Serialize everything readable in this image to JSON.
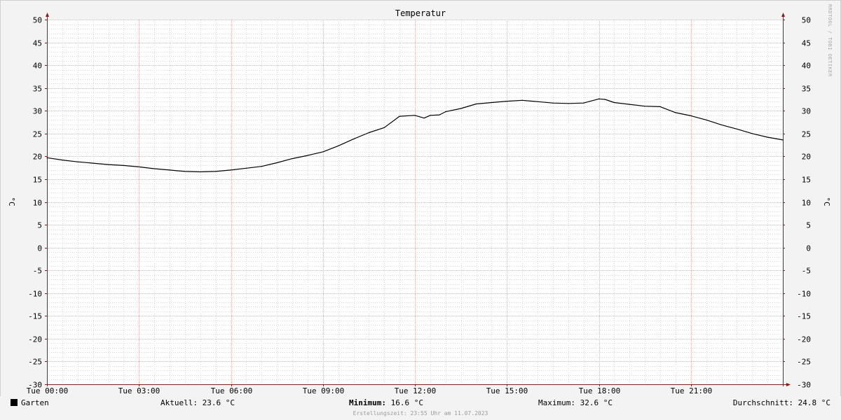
{
  "chart_data": {
    "type": "line",
    "title": "Temperatur",
    "ylabel_left": "°C",
    "ylabel_right": "°C",
    "ylim": [
      -30,
      50
    ],
    "y_ticks": [
      50,
      45,
      40,
      35,
      30,
      25,
      20,
      15,
      10,
      5,
      0,
      -5,
      -10,
      -15,
      -20,
      -25,
      -30
    ],
    "x_ticks": [
      "Tue 00:00",
      "Tue 03:00",
      "Tue 06:00",
      "Tue 09:00",
      "Tue 12:00",
      "Tue 15:00",
      "Tue 18:00",
      "Tue 21:00"
    ],
    "x_unit": "hours",
    "xlim": [
      0,
      24
    ],
    "grid": true,
    "colors": {
      "line": "#000000",
      "major_grid": "#f0a8a8",
      "minor_grid": "#d8d8d8",
      "axis": "#8b1a1a",
      "plot_bg": "#ffffff",
      "canvas_bg": "#f3f3f3"
    },
    "series": [
      {
        "name": "Garten",
        "x": [
          0,
          0.5,
          1,
          1.5,
          2,
          2.5,
          3,
          3.5,
          4,
          4.5,
          5,
          5.5,
          6,
          6.5,
          7,
          7.5,
          8,
          8.5,
          9,
          9.5,
          10,
          10.5,
          11,
          11.5,
          12,
          12.3,
          12.5,
          12.8,
          13,
          13.5,
          14,
          14.5,
          15,
          15.5,
          16,
          16.5,
          17,
          17.5,
          18,
          18.2,
          18.5,
          19,
          19.5,
          20,
          20.5,
          21,
          21.5,
          22,
          22.5,
          23,
          23.5,
          24
        ],
        "values": [
          19.7,
          19.2,
          18.8,
          18.5,
          18.2,
          18.0,
          17.7,
          17.3,
          17.0,
          16.7,
          16.6,
          16.7,
          17.0,
          17.4,
          17.8,
          18.6,
          19.5,
          20.2,
          21.0,
          22.3,
          23.8,
          25.2,
          26.3,
          28.8,
          29.0,
          28.4,
          29.0,
          29.1,
          29.8,
          30.5,
          31.5,
          31.8,
          32.1,
          32.3,
          32.0,
          31.7,
          31.6,
          31.7,
          32.6,
          32.5,
          31.8,
          31.4,
          31.0,
          30.9,
          29.6,
          28.9,
          28.0,
          26.9,
          26.0,
          25.0,
          24.2,
          23.6
        ]
      }
    ]
  },
  "footer": {
    "legend_label": "Garten",
    "current": "Aktuell: 23.6 °C",
    "minimum_label": "Minimum:",
    "minimum_value": " 16.6 °C",
    "maximum": "Maximum: 32.6 °C",
    "average": "Durchschnitt: 24.8 °C",
    "created": "Erstellungszeit: 23:55 Uhr am 11.07.2023"
  },
  "watermark": "RRDTOOL / TOBI OETIKER"
}
